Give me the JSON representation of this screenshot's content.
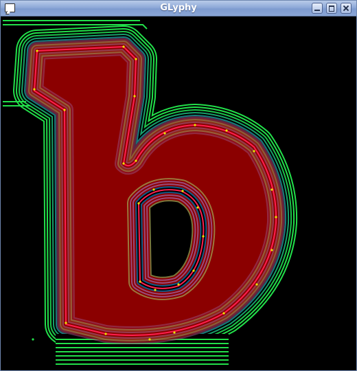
{
  "window": {
    "title": "GLyphy"
  },
  "canvas": {
    "glyph": "b",
    "colors": {
      "background": "#000000",
      "fill": "#8b0000",
      "outline": "#ff1f4f",
      "outer_bands": "#22e04a",
      "inner_bands": "#0f5a88",
      "control_points": "#e6e600"
    }
  },
  "icons": {
    "app": "window-icon",
    "minimize": "minimize-icon",
    "maximize": "maximize-icon",
    "close": "close-icon"
  }
}
